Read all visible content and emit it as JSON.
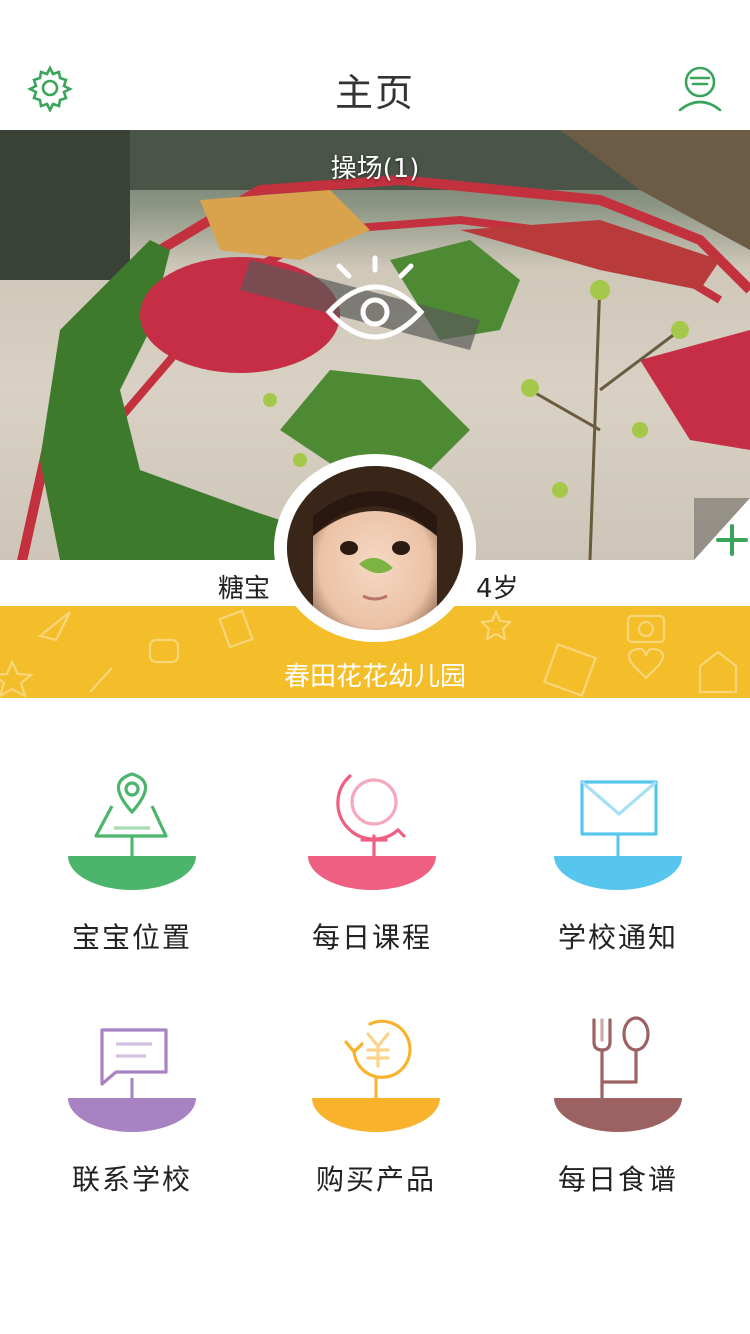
{
  "header": {
    "title": "主页",
    "settings_icon": "gear-icon",
    "profile_icon": "user-profile-icon",
    "accent": "#3aa55a"
  },
  "camera": {
    "label": "操场(1)",
    "view_icon": "eye-icon",
    "add_icon": "plus-icon"
  },
  "child": {
    "name": "糖宝",
    "age": "4岁"
  },
  "school": {
    "name": "春田花花幼儿园",
    "banner_color": "#f4bd2a"
  },
  "menu": [
    {
      "label": "宝宝位置",
      "icon": "location-map-icon",
      "color": "#4cb56c"
    },
    {
      "label": "每日课程",
      "icon": "globe-icon",
      "color": "#ee5f82"
    },
    {
      "label": "学校通知",
      "icon": "envelope-icon",
      "color": "#56c6ee"
    },
    {
      "label": "联系学校",
      "icon": "chat-bubble-icon",
      "color": "#a783c4"
    },
    {
      "label": "购买产品",
      "icon": "yuan-refresh-icon",
      "color": "#f9b22b"
    },
    {
      "label": "每日食谱",
      "icon": "fork-spoon-icon",
      "color": "#9c6161"
    }
  ]
}
